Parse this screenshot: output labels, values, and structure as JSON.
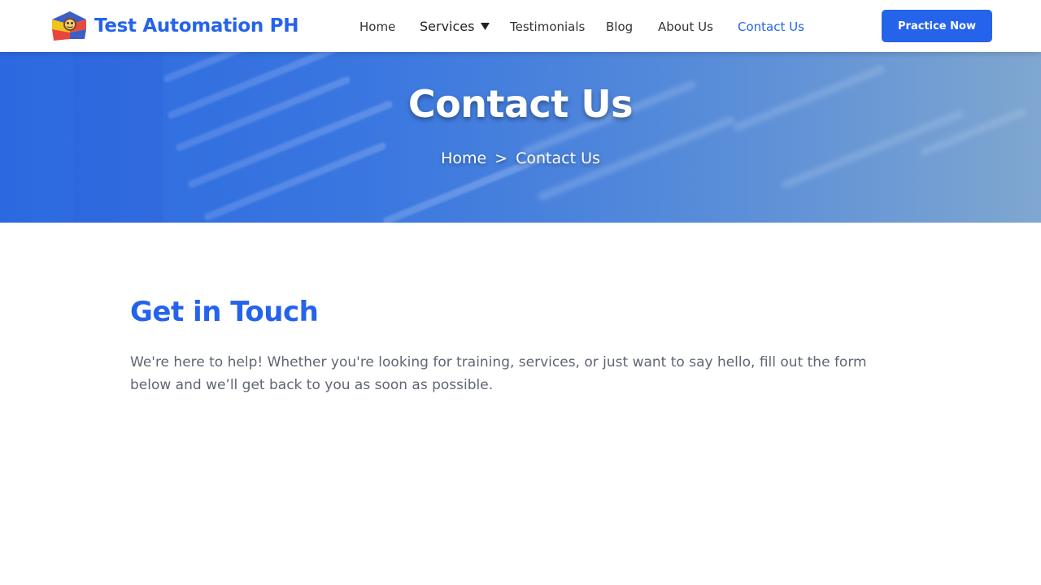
{
  "header": {
    "brand_name": "Test Automation PH",
    "nav": {
      "home": "Home",
      "services": "Services",
      "testimonials": "Testimonials",
      "blog": "Blog",
      "about": "About Us",
      "contact": "Contact Us"
    },
    "active_item": "Contact Us",
    "cta_label": "Practice Now",
    "icons": [
      "logo-icon",
      "chevron-down-icon"
    ]
  },
  "hero": {
    "title": "Contact Us",
    "breadcrumb": {
      "home": "Home",
      "separator": ">",
      "current": "Contact Us"
    }
  },
  "main": {
    "heading": "Get in Touch",
    "intro": "We're here to help! Whether you're looking for training, services, or just want to say hello, fill out the form below and we’ll get back to you as soon as possible."
  },
  "colors": {
    "accent": "#2563eb",
    "nav_text": "#333333",
    "body_text": "#5f6673",
    "hero_start": "#2f6ee3",
    "hero_end": "#7aa3d0"
  }
}
